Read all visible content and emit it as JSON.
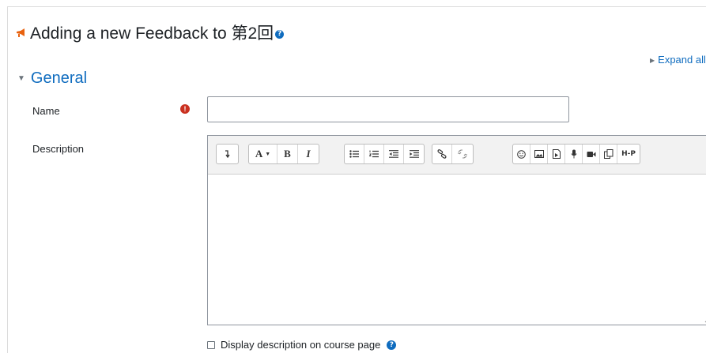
{
  "heading": {
    "title": "Adding a new Feedback to 第2回",
    "module_icon": "feedback-megaphone-icon",
    "help_icon": "?"
  },
  "expand_all": "Expand all",
  "section": {
    "title": "General"
  },
  "fields": {
    "name": {
      "label": "Name",
      "value": "",
      "required_icon": "!"
    },
    "description": {
      "label": "Description",
      "toolbar": {
        "groups": [
          [
            "collapse"
          ],
          [
            "font-style",
            "bold",
            "italic"
          ],
          [
            "unordered-list",
            "ordered-list",
            "outdent",
            "indent"
          ],
          [
            "link",
            "unlink"
          ],
          [
            "emoticon",
            "image",
            "media",
            "record-audio",
            "record-video",
            "manage-files",
            "h5p"
          ]
        ],
        "font_style_label": "A",
        "bold_label": "B",
        "italic_label": "I",
        "h5p_label": "H-P"
      }
    },
    "display_on_course": {
      "label": "Display description on course page",
      "checked": false,
      "help_icon": "?"
    }
  },
  "colors": {
    "link": "#0f6cbf",
    "required": "#ca3120",
    "module_icon": "#e8620f"
  }
}
